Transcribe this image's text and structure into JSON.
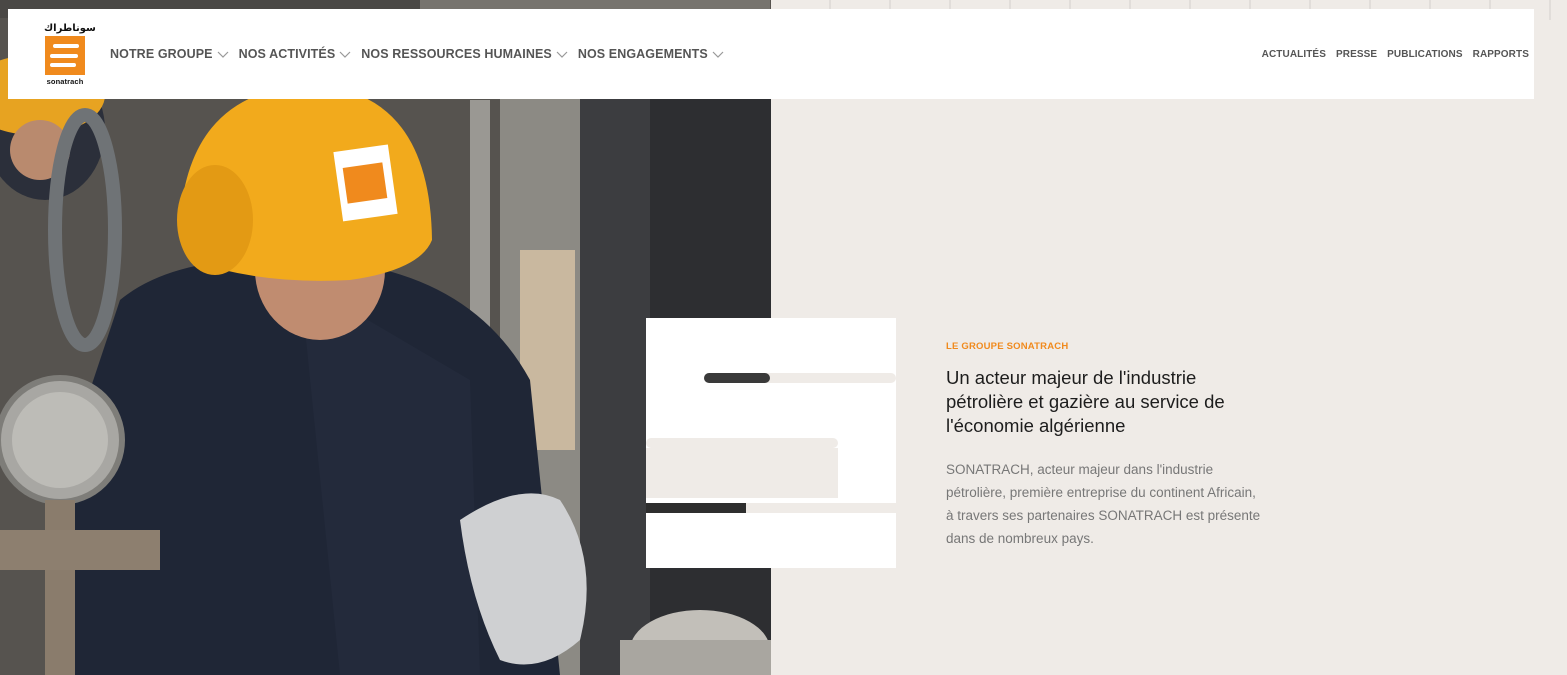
{
  "header": {
    "logo": {
      "arabic": "سوناطراك",
      "wordmark": "sonatrach"
    },
    "main_nav": [
      {
        "label": "NOTRE GROUPE"
      },
      {
        "label": "NOS ACTIVITÉS"
      },
      {
        "label": "NOS RESSOURCES HUMAINES"
      },
      {
        "label": "NOS ENGAGEMENTS"
      }
    ],
    "secondary_nav": [
      {
        "label": "ACTUALITÉS"
      },
      {
        "label": "PRESSE"
      },
      {
        "label": "PUBLICATIONS"
      },
      {
        "label": "RAPPORTS"
      }
    ]
  },
  "intro": {
    "eyebrow": "LE GROUPE SONATRACH",
    "headline": "Un acteur majeur de l'industrie pétrolière et gazière au service de l'économie algérienne",
    "body": "SONATRACH, acteur majeur dans l'industrie pétrolière, première entreprise du continent Africain, à travers ses partenaires SONATRACH est présente dans de nombreux pays."
  },
  "colors": {
    "accent": "#f08a1d",
    "background": "#efebe7",
    "nav_text": "#555555"
  },
  "icons": {
    "nav_chevron": "chevron-down-icon"
  }
}
